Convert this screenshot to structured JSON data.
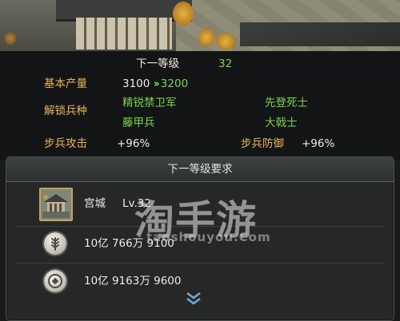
{
  "next_level": {
    "label": "下一等级",
    "value": "32"
  },
  "base_output": {
    "label": "基本产量",
    "current": "3100",
    "next": "3200"
  },
  "unlock": {
    "label": "解锁兵种",
    "units": [
      "精锐禁卫军",
      "先登死士",
      "藤甲兵",
      "大戟士"
    ]
  },
  "infantry_attack": {
    "label": "步兵攻击",
    "value": "+96%"
  },
  "infantry_defense": {
    "label": "步兵防御",
    "value": "+96%"
  },
  "requirements": {
    "title": "下一等级要求",
    "building": {
      "name": "宫城",
      "level": "Lv.32"
    },
    "food": "10亿 766万 9100",
    "coins": "10亿 9163万 9600"
  },
  "watermark": {
    "text": "淘手游",
    "sub": "taoshouyou.Com"
  },
  "colors": {
    "label": "#e7b55b",
    "green": "#79d64a",
    "text": "#f1ece2"
  },
  "icons": [
    "palace-icon",
    "wheat-icon",
    "coin-icon",
    "double-chevron-down-icon",
    "double-arrow-icon"
  ]
}
